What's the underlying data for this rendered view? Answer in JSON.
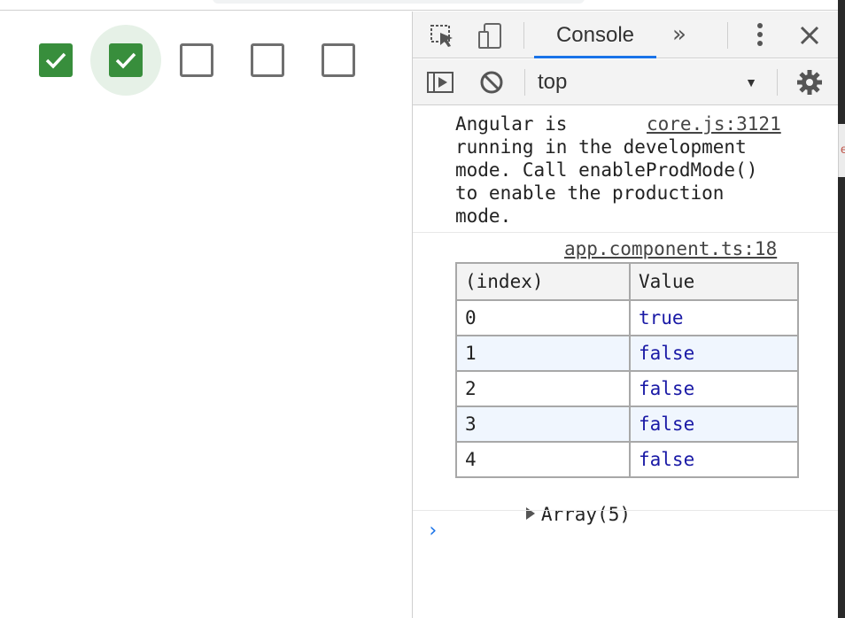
{
  "app": {
    "checkboxes": [
      {
        "checked": true
      },
      {
        "checked": true
      },
      {
        "checked": false
      },
      {
        "checked": false
      },
      {
        "checked": false
      }
    ],
    "accent_color": "#388e3c"
  },
  "devtools": {
    "tabs": {
      "active_label": "Console",
      "more_label": "»"
    },
    "toolbar": {
      "context_value": "top"
    },
    "messages": [
      {
        "text": "Angular is\nrunning in the development\nmode. Call enableProdMode()\nto enable the production\nmode.",
        "source": "core.js:3121"
      },
      {
        "source": "app.component.ts:18"
      }
    ],
    "table": {
      "headers": [
        "(index)",
        "Value"
      ],
      "rows": [
        {
          "index": "0",
          "value": "true"
        },
        {
          "index": "1",
          "value": "false"
        },
        {
          "index": "2",
          "value": "false"
        },
        {
          "index": "3",
          "value": "false"
        },
        {
          "index": "4",
          "value": "false"
        }
      ]
    },
    "array_summary": "Array(5)",
    "prompt_symbol": "›",
    "link_color": "#1a73e8",
    "value_color": "#1a1aa6"
  }
}
